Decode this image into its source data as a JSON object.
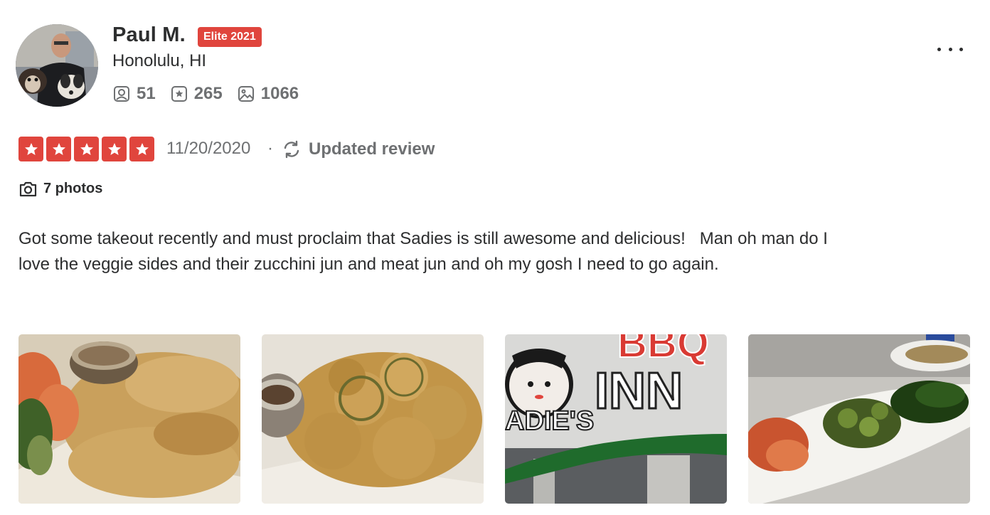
{
  "user": {
    "name": "Paul M.",
    "badge": "Elite 2021",
    "location": "Honolulu, HI",
    "stats": [
      {
        "icon": "friends-icon",
        "value": "51"
      },
      {
        "icon": "reviews-icon",
        "value": "265"
      },
      {
        "icon": "photos-icon",
        "value": "1066"
      }
    ]
  },
  "review": {
    "rating": 5,
    "rating_max": 5,
    "date": "11/20/2020",
    "separator": "·",
    "updated_label": "Updated review",
    "photos_label": "7 photos",
    "text": "Got some takeout recently and must proclaim that Sadies is still awesome and delicious!   Man oh man do I love the veggie sides and their zucchini jun and meat jun and oh my gosh I need to go again.",
    "photos": [
      {
        "name": "review-photo-meat-jun"
      },
      {
        "name": "review-photo-zucchini-jun"
      },
      {
        "name": "review-photo-sadies-bbq-inn-sign"
      },
      {
        "name": "review-photo-veggie-sides"
      }
    ]
  },
  "colors": {
    "accent_red": "#e0453d",
    "text_primary": "#2d2e2f",
    "text_muted": "#6e7072"
  },
  "photo_text": {
    "sign_top": "BBQ",
    "sign_main": "INN",
    "sign_left": "ADIE'S"
  }
}
